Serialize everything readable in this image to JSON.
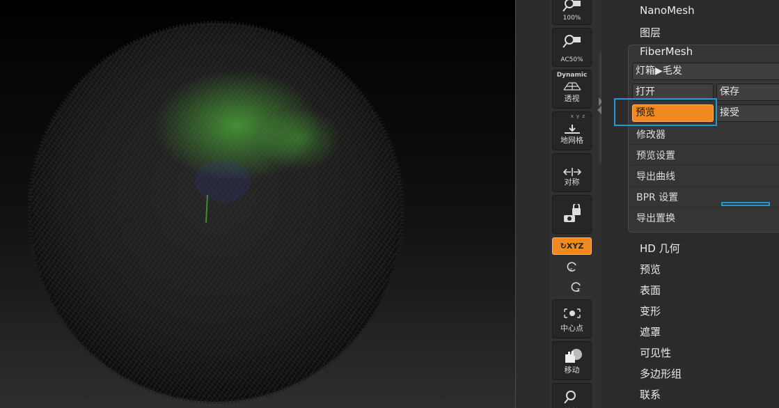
{
  "colors": {
    "accent_orange": "#f08a20",
    "highlight_blue": "#1e9ad6",
    "fiber_green": "#4fb33a"
  },
  "viewport": {
    "object": "fiber-sphere"
  },
  "shelf": {
    "btn_100": "100%",
    "btn_ac50": "AC50%",
    "btn_persp_top": "Dynamic",
    "btn_persp": "透视",
    "btn_floor_top": "x y z",
    "btn_floor": "地网格",
    "btn_sym": "对称",
    "btn_lock": "",
    "btn_xyz": "XYZ",
    "btn_center": "中心点",
    "btn_move": "移动",
    "btn_zoom": "缩放"
  },
  "panel": {
    "items_top": [
      "NanoMesh",
      "图层"
    ],
    "fiber_title": "FiberMesh",
    "lightbox": "灯箱▶毛发",
    "open": "打开",
    "save": "保存",
    "preview_btn": "预览",
    "accept": "接受",
    "sub_items": [
      "修改器",
      "预览设置",
      "导出曲线",
      "BPR 设置",
      "导出置换"
    ],
    "items_bottom": [
      "HD 几何",
      "预览",
      "表面",
      "变形",
      "遮罩",
      "可见性",
      "多边形组",
      "联系"
    ]
  }
}
